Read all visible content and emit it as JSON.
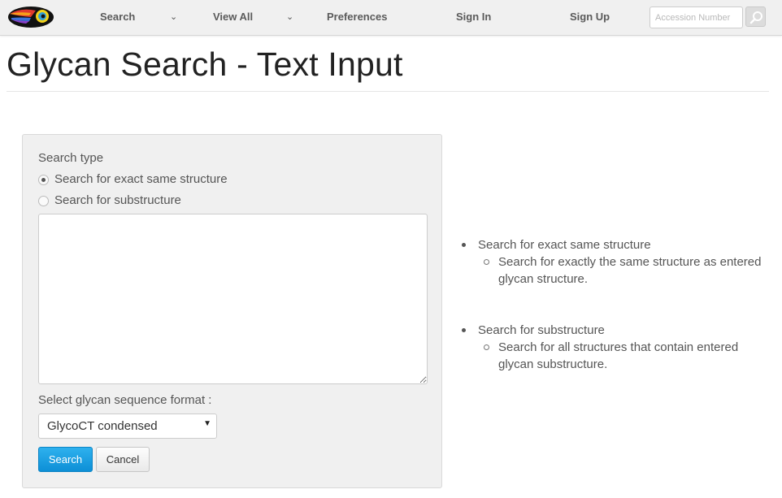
{
  "navbar": {
    "items": [
      {
        "label": "Search",
        "has_dropdown": true
      },
      {
        "label": "View All",
        "has_dropdown": true
      },
      {
        "label": "Preferences"
      },
      {
        "label": "Sign In"
      },
      {
        "label": "Sign Up"
      }
    ],
    "dropdown_caret": "⌄",
    "accession_placeholder": "Accession Number",
    "search_icon": "magnifier-icon"
  },
  "page": {
    "title": "Glycan Search - Text Input"
  },
  "form": {
    "search_type_label": "Search type",
    "options": [
      {
        "label": "Search for exact same structure",
        "checked": true
      },
      {
        "label": "Search for substructure",
        "checked": false
      }
    ],
    "sequence_value": "",
    "format_label": "Select glycan sequence format :",
    "format_selected": "GlycoCT condensed",
    "format_arrow": "▼",
    "search_button": "Search",
    "cancel_button": "Cancel"
  },
  "help": [
    {
      "title": "Search for exact same structure",
      "detail": "Search for exactly the same structure as entered glycan structure."
    },
    {
      "title": "Search for substructure",
      "detail": "Search for all structures that contain entered glycan substructure."
    }
  ],
  "colors": {
    "primary": "#1a9fe0",
    "navbar_bg": "#f0f0f0",
    "panel_bg": "#f0f0f0"
  }
}
